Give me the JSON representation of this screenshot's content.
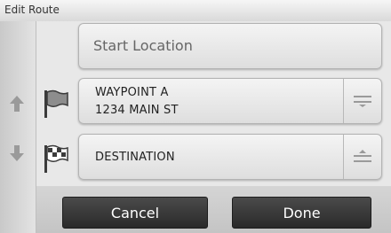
{
  "window": {
    "title": "Edit Route"
  },
  "route": {
    "start_placeholder": "Start Location",
    "waypoint": {
      "name": "WAYPOINT A",
      "address": "1234 MAIN ST"
    },
    "destination": {
      "name": "DESTINATION"
    }
  },
  "actions": {
    "cancel_label": "Cancel",
    "done_label": "Done"
  },
  "icons": {
    "move_up": "arrow-up-icon",
    "move_down": "arrow-down-icon",
    "waypoint_flag": "flag-icon",
    "destination_flag": "checkered-flag-icon",
    "drag_handle": "drag-handle-icon"
  },
  "colors": {
    "button_bg": "#2f2f2f",
    "button_text": "#ffffff",
    "field_bg": "#ececec"
  }
}
